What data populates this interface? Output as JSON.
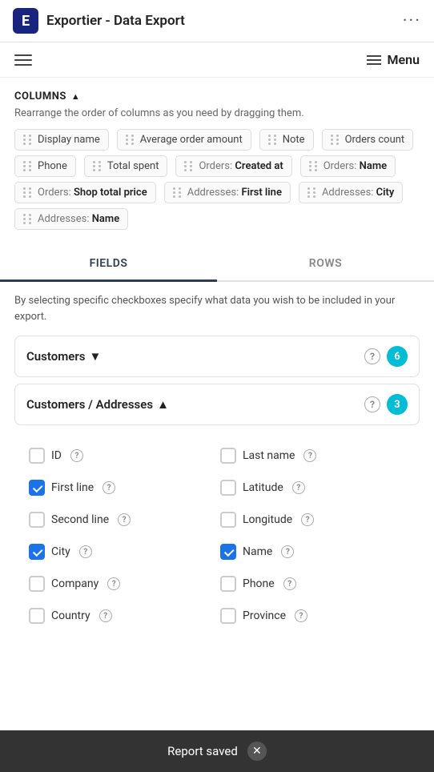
{
  "app": {
    "icon_letter": "E",
    "title": "Exportier - Data Export",
    "dots_label": "···"
  },
  "nav": {
    "menu_label": "Menu"
  },
  "columns": {
    "header": "COLUMNS",
    "header_chevron": "▲",
    "description": "Rearrange the order of columns as you need by dragging them.",
    "tags": [
      {
        "id": "display-name",
        "text": "Display name",
        "prefix": ""
      },
      {
        "id": "avg-order",
        "text": "Average order amount",
        "prefix": ""
      },
      {
        "id": "note",
        "text": "Note",
        "prefix": ""
      },
      {
        "id": "orders-count",
        "text": "Orders count",
        "prefix": ""
      },
      {
        "id": "phone",
        "text": "Phone",
        "prefix": ""
      },
      {
        "id": "total-spent",
        "text": "Total spent",
        "prefix": ""
      },
      {
        "id": "orders-created",
        "text": "Created at",
        "prefix": "Orders: "
      },
      {
        "id": "orders-name",
        "text": "Name",
        "prefix": "Orders: "
      },
      {
        "id": "orders-shop-total",
        "text": "Shop total price",
        "prefix": "Orders: "
      },
      {
        "id": "addresses-first-line",
        "text": "First line",
        "prefix": "Addresses: "
      },
      {
        "id": "addresses-city",
        "text": "City",
        "prefix": "Addresses: "
      },
      {
        "id": "addresses-name",
        "text": "Name",
        "prefix": "Addresses: "
      }
    ]
  },
  "tabs": [
    {
      "id": "fields",
      "label": "FIELDS",
      "active": true
    },
    {
      "id": "rows",
      "label": "ROWS",
      "active": false
    }
  ],
  "fields": {
    "description": "By selecting specific checkboxes specify what data you wish to be included in your export.",
    "accordions": [
      {
        "id": "customers",
        "label": "Customers",
        "chevron": "▼",
        "badge": "6",
        "expanded": false
      },
      {
        "id": "customers-addresses",
        "label": "Customers / Addresses",
        "chevron": "▲",
        "badge": "3",
        "expanded": true
      }
    ],
    "checkboxes": [
      {
        "id": "id",
        "label": "ID",
        "checked": false,
        "col": 0
      },
      {
        "id": "last-name",
        "label": "Last name",
        "checked": false,
        "col": 1
      },
      {
        "id": "first-line",
        "label": "First line",
        "checked": true,
        "col": 0
      },
      {
        "id": "latitude",
        "label": "Latitude",
        "checked": false,
        "col": 1
      },
      {
        "id": "second-line",
        "label": "Second line",
        "checked": false,
        "col": 0
      },
      {
        "id": "longitude",
        "label": "Longitude",
        "checked": false,
        "col": 1
      },
      {
        "id": "city",
        "label": "City",
        "checked": true,
        "col": 0
      },
      {
        "id": "name",
        "label": "Name",
        "checked": true,
        "col": 1
      },
      {
        "id": "company",
        "label": "Company",
        "checked": false,
        "col": 0
      },
      {
        "id": "phone",
        "label": "Phone",
        "checked": false,
        "col": 1
      },
      {
        "id": "country",
        "label": "Country",
        "checked": false,
        "col": 0
      },
      {
        "id": "province",
        "label": "Province",
        "checked": false,
        "col": 1
      }
    ]
  },
  "toast": {
    "message": "Report saved",
    "close_label": "✕"
  }
}
